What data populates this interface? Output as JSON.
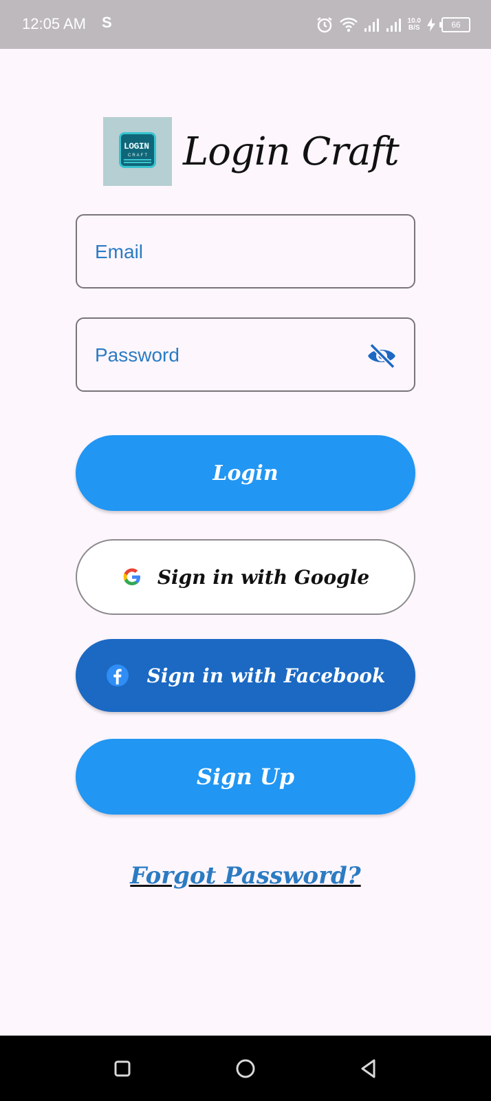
{
  "status_bar": {
    "time": "12:05 AM",
    "network_speed_value": "10.0",
    "network_speed_unit": "B/S",
    "battery": "66"
  },
  "header": {
    "logo_text": "LOGIN",
    "logo_subtext": "CRAFT",
    "title": "Login Craft"
  },
  "form": {
    "email_placeholder": "Email",
    "password_placeholder": "Password"
  },
  "buttons": {
    "login": "Login",
    "google": "Sign in with Google",
    "facebook": "Sign in with Facebook",
    "signup": "Sign Up"
  },
  "links": {
    "forgot_password": "Forgot Password?"
  },
  "colors": {
    "primary": "#2196f3",
    "facebook": "#1b69c3",
    "accent_text": "#2b7bc2",
    "background": "#fdf6fd"
  }
}
